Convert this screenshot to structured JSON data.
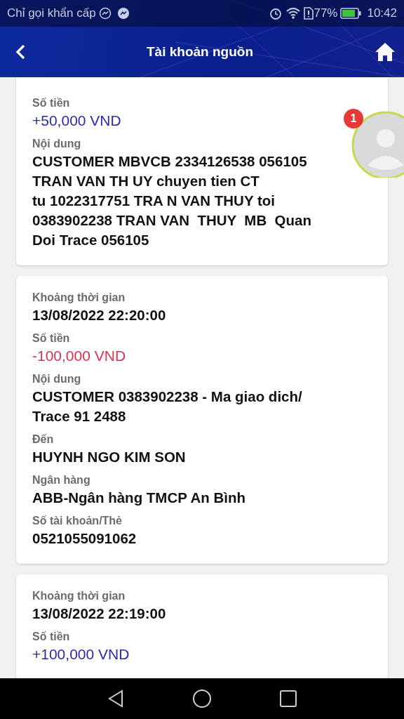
{
  "status_bar": {
    "carrier": "Chỉ gọi khẩn cấp",
    "battery_text": "77%",
    "time": "10:42"
  },
  "header": {
    "title": "Tài khoản nguồn"
  },
  "chat_head": {
    "badge": "1"
  },
  "cards": [
    {
      "fields": [
        {
          "label": "Số tiền",
          "value": "+50,000 VND",
          "kind": "credit"
        },
        {
          "label": "Nội dung",
          "value": "CUSTOMER MBVCB 2334126538 056105\nTRAN VAN TH UY chuyen tien CT\ntu 1022317751 TRA N VAN THUY toi\n0383902238 TRAN VAN  THUY  MB  Quan\nDoi Trace 056105",
          "kind": "text"
        }
      ]
    },
    {
      "fields": [
        {
          "label": "Khoảng thời gian",
          "value": "13/08/2022 22:20:00",
          "kind": "text"
        },
        {
          "label": "Số tiền",
          "value": "-100,000 VND",
          "kind": "debit"
        },
        {
          "label": "Nội dung",
          "value": "CUSTOMER 0383902238 - Ma giao dich/\nTrace 91 2488",
          "kind": "text"
        },
        {
          "label": "Đến",
          "value": "HUYNH NGO KIM SON",
          "kind": "text"
        },
        {
          "label": "Ngân hàng",
          "value": "ABB-Ngân hàng TMCP An Bình",
          "kind": "text"
        },
        {
          "label": "Số tài khoản/Thẻ",
          "value": "0521055091062",
          "kind": "text"
        }
      ]
    },
    {
      "fields": [
        {
          "label": "Khoảng thời gian",
          "value": "13/08/2022 22:19:00",
          "kind": "text"
        },
        {
          "label": "Số tiền",
          "value": "+100,000 VND",
          "kind": "credit"
        }
      ]
    }
  ]
}
